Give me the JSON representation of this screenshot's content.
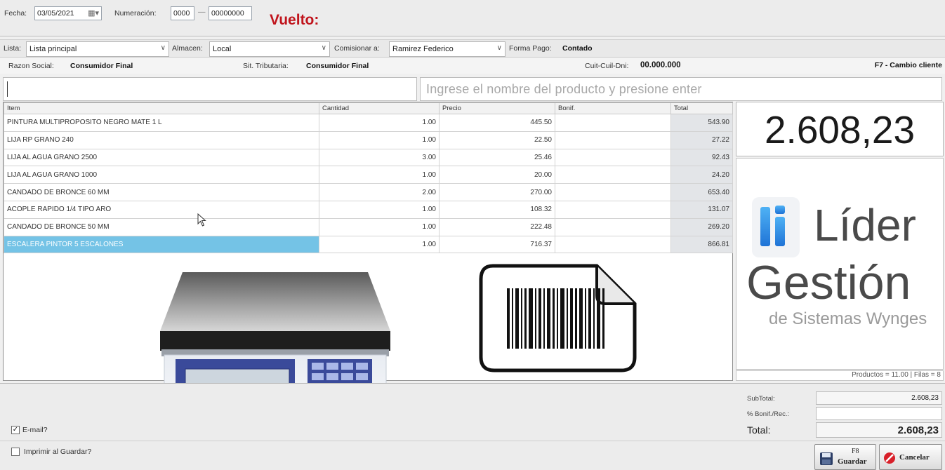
{
  "header": {
    "fecha_label": "Fecha:",
    "fecha_value": "03/05/2021",
    "numeracion_label": "Numeración:",
    "numeracion_prefix": "0000",
    "numeracion_sep": "—",
    "numeracion_number": "00000000",
    "vuelto_label": "Vuelto:"
  },
  "options": {
    "lista_label": "Lista:",
    "lista_value": "Lista principal",
    "almacen_label": "Almacen:",
    "almacen_value": "Local",
    "comisionar_label": "Comisionar a:",
    "comisionar_value": "Ramirez Federico",
    "forma_pago_label": "Forma Pago:",
    "forma_pago_value": "Contado"
  },
  "client": {
    "razon_label": "Razon Social:",
    "razon_value": "Consumidor Final",
    "sit_label": "Sit. Tributaria:",
    "sit_value": "Consumidor Final",
    "cuit_label": "Cuit-Cuil-Dni:",
    "cuit_value": "00.000.000",
    "cambio_cliente": "F7 - Cambio cliente"
  },
  "search": {
    "placeholder": "Ingrese el nombre del producto y presione enter"
  },
  "grid": {
    "columns": [
      "Item",
      "Cantidad",
      "Precio",
      "Bonif.",
      "Total"
    ],
    "rows": [
      {
        "item": "PINTURA MULTIPROPOSITO NEGRO MATE 1 L",
        "cantidad": "1.00",
        "precio": "445.50",
        "bonif": "",
        "total": "543.90"
      },
      {
        "item": "LIJA RP GRANO 240",
        "cantidad": "1.00",
        "precio": "22.50",
        "bonif": "",
        "total": "27.22"
      },
      {
        "item": "LIJA AL AGUA GRANO 2500",
        "cantidad": "3.00",
        "precio": "25.46",
        "bonif": "",
        "total": "92.43"
      },
      {
        "item": "LIJA AL AGUA GRANO 1000",
        "cantidad": "1.00",
        "precio": "20.00",
        "bonif": "",
        "total": "24.20"
      },
      {
        "item": "CANDADO DE BRONCE 60 MM",
        "cantidad": "2.00",
        "precio": "270.00",
        "bonif": "",
        "total": "653.40"
      },
      {
        "item": "ACOPLE RAPIDO 1/4 TIPO ARO",
        "cantidad": "1.00",
        "precio": "108.32",
        "bonif": "",
        "total": "131.07"
      },
      {
        "item": "CANDADO DE BRONCE 50 MM",
        "cantidad": "1.00",
        "precio": "222.48",
        "bonif": "",
        "total": "269.20"
      },
      {
        "item": "ESCALERA PINTOR 5 ESCALONES",
        "cantidad": "1.00",
        "precio": "716.37",
        "bonif": "",
        "total": "866.81"
      }
    ]
  },
  "summary": {
    "big_total": "2.608,23",
    "counts": "Productos = 11.00 | Filas = 8",
    "subtotal_label": "SubTotal:",
    "subtotal_value": "2.608,23",
    "bonif_label": "% Bonif./Rec.:",
    "bonif_value": "",
    "total_label": "Total:",
    "total_value": "2.608,23"
  },
  "logo": {
    "mark": "li",
    "word1": "Líder",
    "word2": "Gestión",
    "tagline": "de Sistemas Wynges"
  },
  "footer": {
    "email_label": "E-mail?",
    "email_checked": true,
    "imprimir_label": "Imprimir al Guardar?",
    "imprimir_checked": false,
    "guardar_key": "F8",
    "guardar_label": "Guardar",
    "cancelar_label": "Cancelar"
  },
  "colors": {
    "vuelto": "#c0141c",
    "selected_row": "#74c3e6",
    "logo_blue": "#2f8fe6"
  }
}
